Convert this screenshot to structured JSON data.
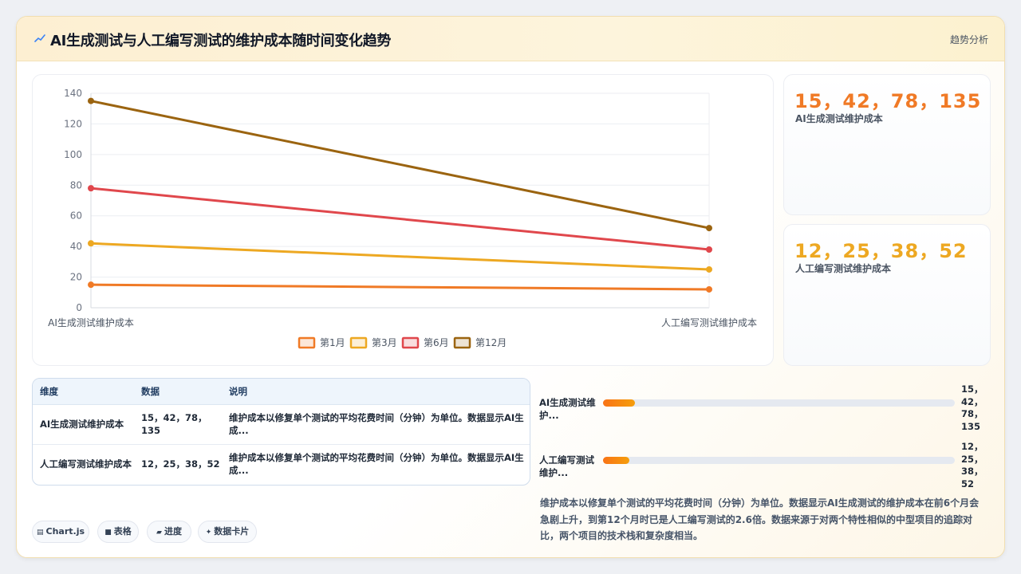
{
  "header": {
    "title": "AI生成测试与人工编写测试的维护成本随时间变化趋势",
    "tag": "趋势分析",
    "accent": "#3b82f6"
  },
  "chart_data": {
    "type": "line",
    "categories": [
      "AI生成测试维护成本",
      "人工编写测试维护成本"
    ],
    "series": [
      {
        "name": "第1月",
        "values": [
          15,
          12
        ],
        "color": "#f07a26"
      },
      {
        "name": "第3月",
        "values": [
          42,
          25
        ],
        "color": "#eda822"
      },
      {
        "name": "第6月",
        "values": [
          78,
          38
        ],
        "color": "#e0474c"
      },
      {
        "name": "第12月",
        "values": [
          135,
          52
        ],
        "color": "#9b6410"
      }
    ],
    "ylim": [
      0,
      140
    ],
    "yticks": [
      0,
      20,
      40,
      60,
      80,
      100,
      120,
      140
    ],
    "grid": true,
    "legend": "bottom"
  },
  "stats": [
    {
      "value": "15，42，78，135",
      "label": "AI生成测试维护成本",
      "color": "#f07a26"
    },
    {
      "value": "12，25，38，52",
      "label": "人工编写测试维护成本",
      "color": "#eda822"
    }
  ],
  "table": {
    "headers": [
      "维度",
      "数据",
      "说明"
    ],
    "rows": [
      [
        "AI生成测试维护成本",
        "15，42，78，135",
        "维护成本以修复单个测试的平均花费时间（分钟）为单位。数据显示AI生成..."
      ],
      [
        "人工编写测试维护成本",
        "12，25，38，52",
        "维护成本以修复单个测试的平均花费时间（分钟）为单位。数据显示AI生成..."
      ]
    ]
  },
  "progress": [
    {
      "label": "AI生成测试维护...",
      "value": "15，42，78，135",
      "fraction": 0.09
    },
    {
      "label": "人工编写测试维护...",
      "value": "12，25，38，52",
      "fraction": 0.075
    }
  ],
  "note": "维护成本以修复单个测试的平均花费时间（分钟）为单位。数据显示AI生成测试的维护成本在前6个月会急剧上升，到第12个月时已是人工编写测试的2.6倍。数据来源于对两个特性相似的中型项目的追踪对比，两个项目的技术栈和复杂度相当。",
  "chips": [
    {
      "icon": "chart-icon",
      "label": "Chart.js"
    },
    {
      "icon": "table-icon",
      "label": "表格"
    },
    {
      "icon": "progress-icon",
      "label": "进度"
    },
    {
      "icon": "card-icon",
      "label": "数据卡片"
    }
  ]
}
